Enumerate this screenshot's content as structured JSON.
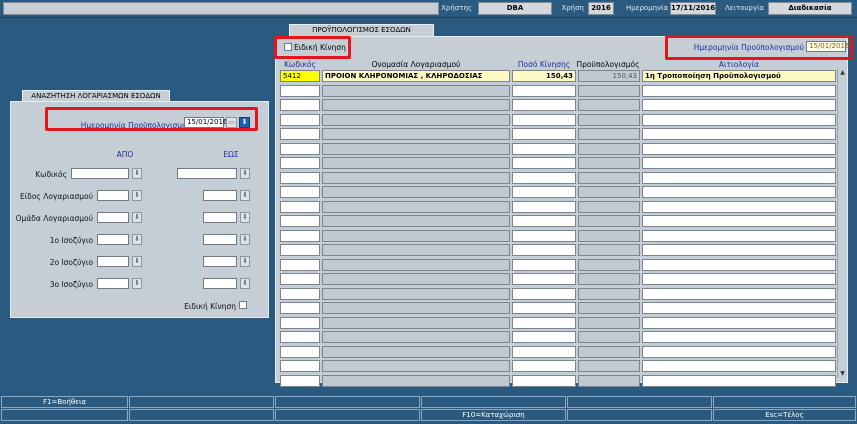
{
  "topbar": {
    "user_label": "Χρήστης",
    "user_value": "DBA",
    "year_label": "Χρήση",
    "year_value": "2016",
    "date_label": "Ημερομηνία",
    "date_value": "17/11/2016",
    "function_label": "Λειτουργία",
    "function_value": "Διαδικασία"
  },
  "grid_tab": "ΠΡΟΫΠΟΛΟΓΙΣΜΟΣ ΕΣΟΔΩΝ",
  "special_move_label": "Ειδική Κίνηση",
  "budget_date": {
    "label": "Ημερομηνία Προϋπολογισμού",
    "value": "15/01/2016"
  },
  "columns": {
    "code": "Κωδικός",
    "account_name": "Ονομασία Λογαριασμού",
    "amount": "Ποσό Κίνησης",
    "budget": "Προϋπολογισμός",
    "reason": "Αιτιολογία"
  },
  "rows": [
    {
      "code": "5412",
      "account_name": "ΠΡΟΙΟΝ  ΚΛΗΡΟΝΟΜΙΑΣ , ΚΛΗΡΟΔΟΣΙΑΣ",
      "amount": "150,43",
      "budget": "150,43",
      "reason": "1η Τροποποίηση Προϋπολογισμού"
    }
  ],
  "search": {
    "tab": "ΑΝΑΖΗΤΗΣΗ ΛΟΓΑΡΙΑΣΜΩΝ ΕΣΟΔΩΝ",
    "date_label": "Ημερομηνία Προϋπολογισμού",
    "date_value": "15/01/2016",
    "from_label": "ΑΠΟ",
    "to_label": "ΕΩΣ",
    "fields": [
      {
        "label": "Κωδικός"
      },
      {
        "label": "Είδος Λογαριασμού"
      },
      {
        "label": "Ομάδα Λογαριασμού"
      },
      {
        "label": "1ο Ισοζύγιο"
      },
      {
        "label": "2ο Ισοζύγιο"
      },
      {
        "label": "3ο Ισοζύγιο"
      }
    ],
    "special_move_label": "Ειδική Κίνηση"
  },
  "function_keys": {
    "help": "F1=Βοήθεια",
    "save": "F10=Καταχώριση",
    "exit": "Esc=Τέλος"
  },
  "icons": {
    "lov_button": "down-arrow-icon",
    "calendar_button": "calendar-icon"
  }
}
